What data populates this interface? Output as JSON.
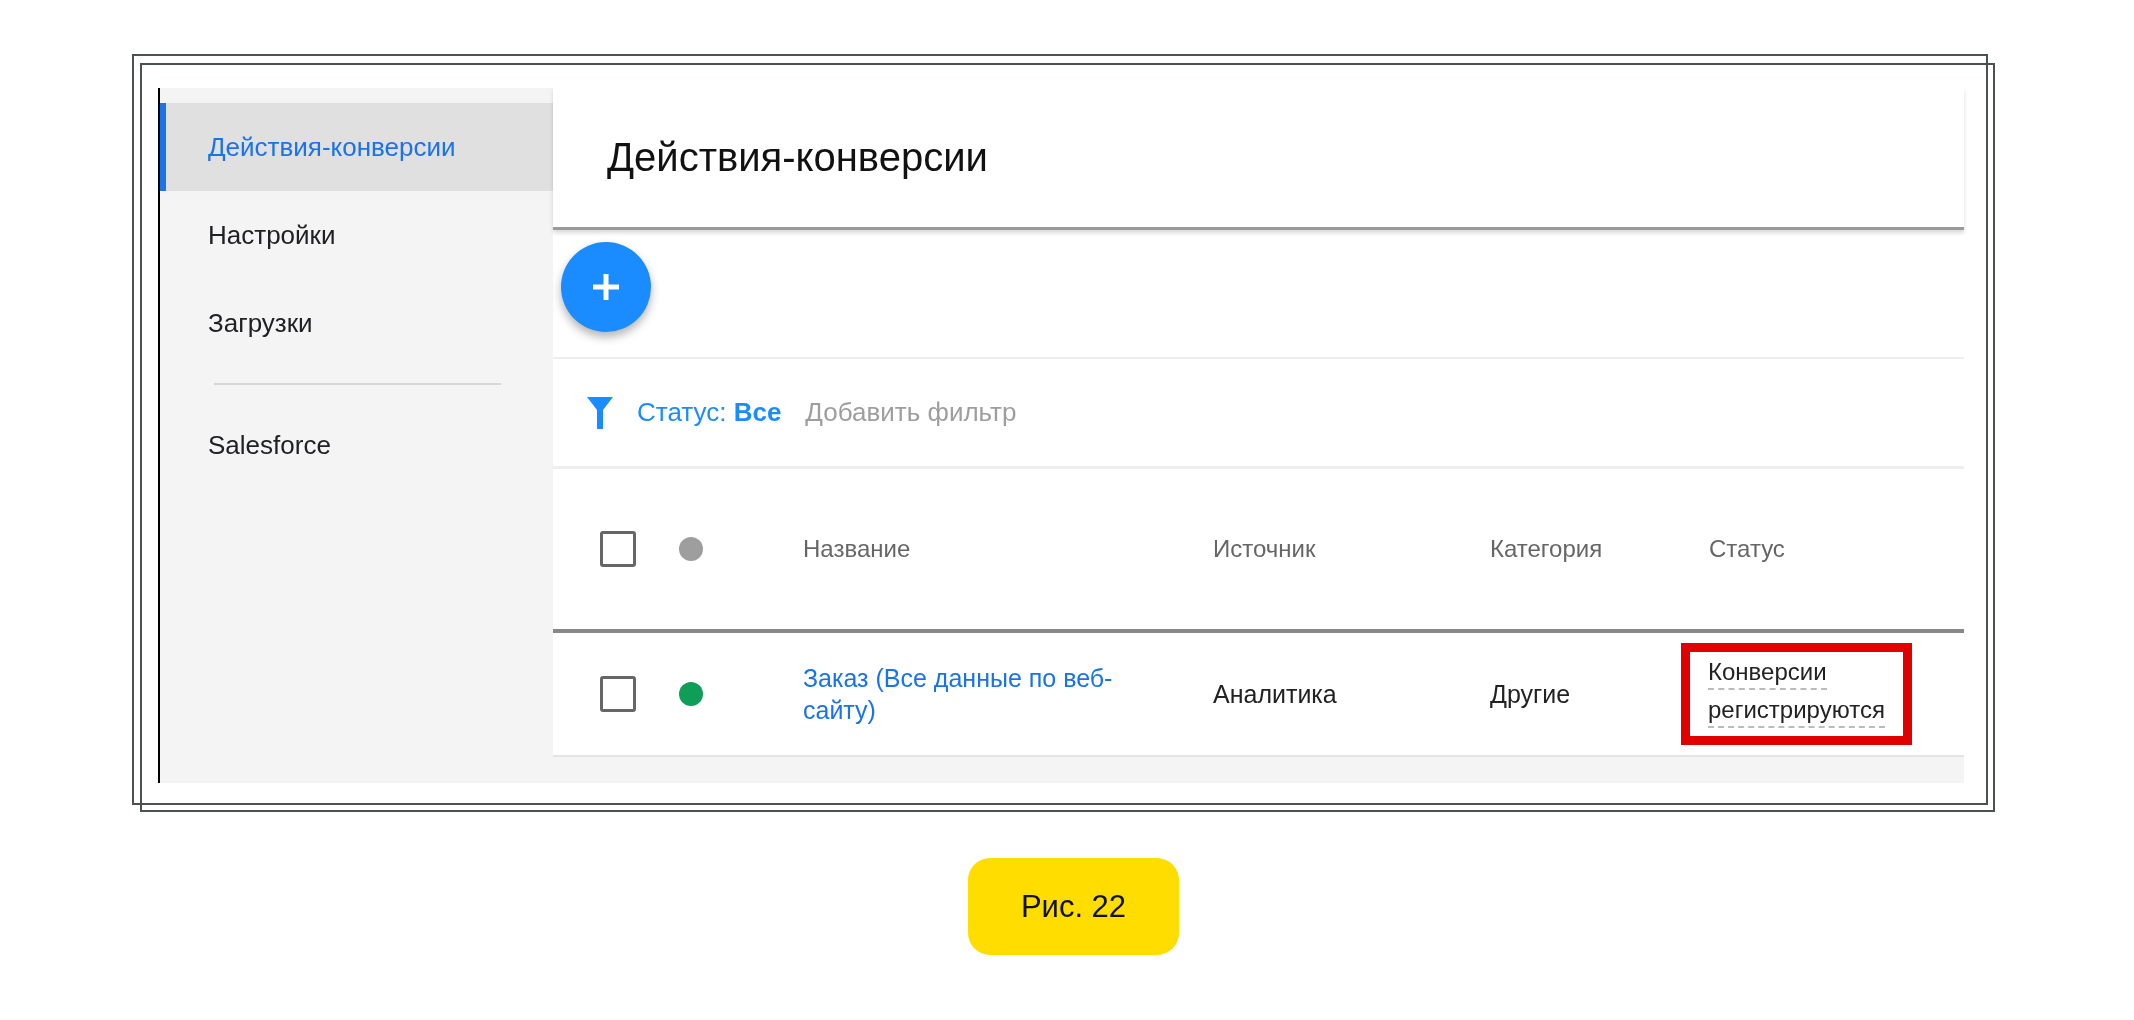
{
  "sidebar": {
    "sections": [
      {
        "items": [
          {
            "label": "Действия-конверсии",
            "selected": true
          },
          {
            "label": "Настройки",
            "selected": false
          },
          {
            "label": "Загрузки",
            "selected": false
          }
        ]
      },
      {
        "items": [
          {
            "label": "Salesforce",
            "selected": false
          }
        ]
      }
    ]
  },
  "header": {
    "title": "Действия-конверсии"
  },
  "filter": {
    "label": "Статус:",
    "value": "Все",
    "add": "Добавить фильтр"
  },
  "table": {
    "header": {
      "checked": false,
      "color": "#9e9e9e"
    },
    "columns": [
      "Название",
      "Источник",
      "Категория",
      "Статус"
    ],
    "rows": [
      {
        "checked": false,
        "color": "#0f9d58",
        "name": "Заказ (Все данные по веб-сайту)",
        "source": "Аналитика",
        "category": "Другие",
        "status": [
          "Конверсии",
          "регистрируются"
        ],
        "highlighted": true
      }
    ]
  },
  "caption": "Рис. 22"
}
